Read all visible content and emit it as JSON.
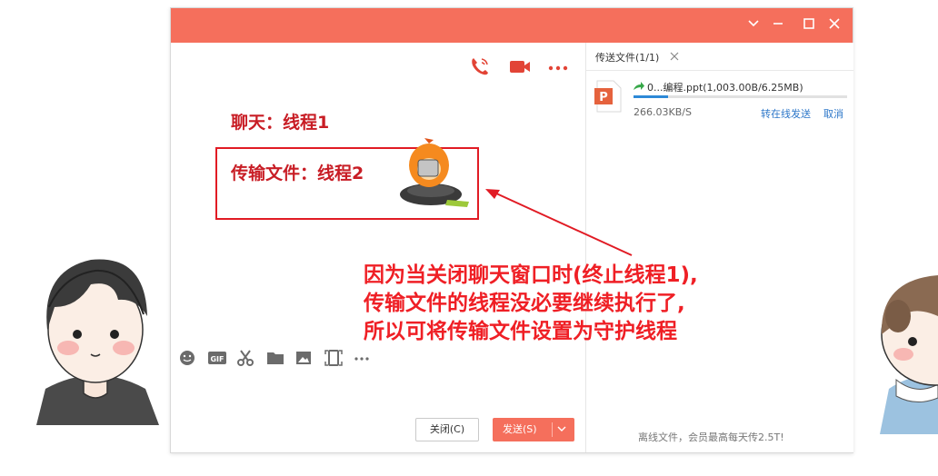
{
  "window": {
    "controls": [
      "chevron-down-icon",
      "minimize-icon",
      "maximize-icon",
      "close-icon"
    ]
  },
  "chat": {
    "header_icons": [
      "phone-call-icon",
      "video-call-icon",
      "more-icon"
    ],
    "annotation_chat": "聊天：线程1",
    "annotation_transfer": "传输文件：线程2",
    "toolbar_icons": [
      "emoji-icon",
      "gif-icon",
      "scissors-icon",
      "folder-icon",
      "image-icon",
      "screen-share-icon",
      "more-icon"
    ],
    "close_button": "关闭(C)",
    "send_button": "发送(S)"
  },
  "transfer": {
    "tab_label": "传送文件(1/1)",
    "file_name": "0...编程.ppt(1,003.00B/6.25MB)",
    "progress_fraction": 0.16,
    "speed": "266.03KB/S",
    "to_offline": "转在线发送",
    "cancel": "取消",
    "footer_note": "离线文件，会员最高每天传2.5T!"
  },
  "callout": {
    "line1": "因为当关闭聊天窗口时(终止线程1),",
    "line2": "传输文件的线程没必要继续执行了,",
    "line3": "所以可将传输文件设置为守护线程"
  },
  "colors": {
    "titlebar": "#f56f5c",
    "accent_red": "#e11b24",
    "send_button": "#f56f5c",
    "link_blue": "#2d77c9"
  }
}
